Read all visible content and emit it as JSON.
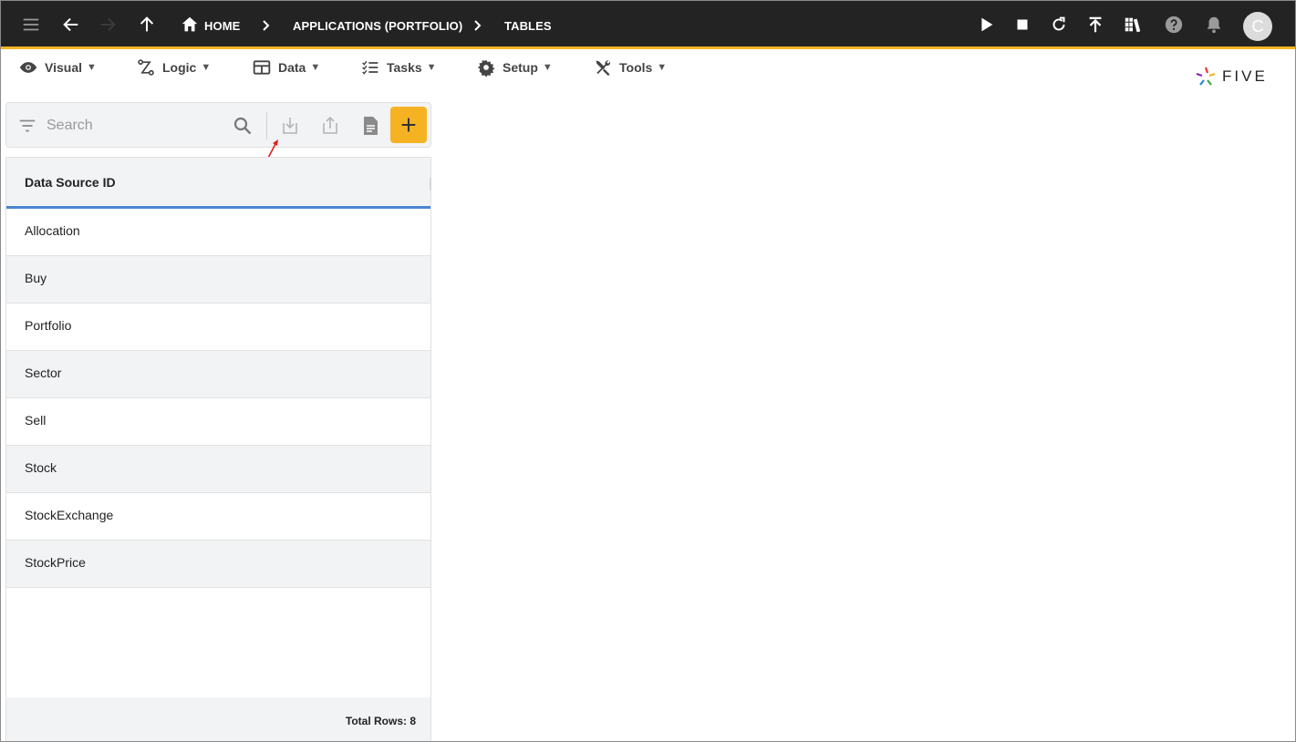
{
  "topbar": {
    "breadcrumbs": [
      {
        "label": "HOME"
      },
      {
        "label": "APPLICATIONS (PORTFOLIO)"
      },
      {
        "label": "TABLES"
      }
    ],
    "avatar_initial": "C",
    "icons": [
      "menu-icon",
      "back-arrow-icon",
      "forward-arrow-icon",
      "up-arrow-icon",
      "home-icon",
      "play-icon",
      "stop-icon",
      "refresh-icon",
      "deploy-icon",
      "library-icon",
      "help-icon",
      "bell-icon"
    ]
  },
  "menubar": {
    "items": [
      {
        "label": "Visual",
        "icon": "eye-icon"
      },
      {
        "label": "Logic",
        "icon": "flow-icon"
      },
      {
        "label": "Data",
        "icon": "table-icon"
      },
      {
        "label": "Tasks",
        "icon": "checklist-icon"
      },
      {
        "label": "Setup",
        "icon": "gear-icon"
      },
      {
        "label": "Tools",
        "icon": "tools-icon"
      }
    ],
    "caret": "▼"
  },
  "logo": {
    "text": "FIVE"
  },
  "search": {
    "placeholder": "Search"
  },
  "table": {
    "header": "Data Source ID",
    "rows": [
      "Allocation",
      "Buy",
      "Portfolio",
      "Sector",
      "Sell",
      "Stock",
      "StockExchange",
      "StockPrice"
    ],
    "footer": "Total Rows: 8"
  },
  "colors": {
    "topbar_bg": "#232323",
    "accent": "#f5b324",
    "header_underline": "#4a86d1",
    "row_alt": "#f2f3f5",
    "annotation": "#e02020"
  }
}
